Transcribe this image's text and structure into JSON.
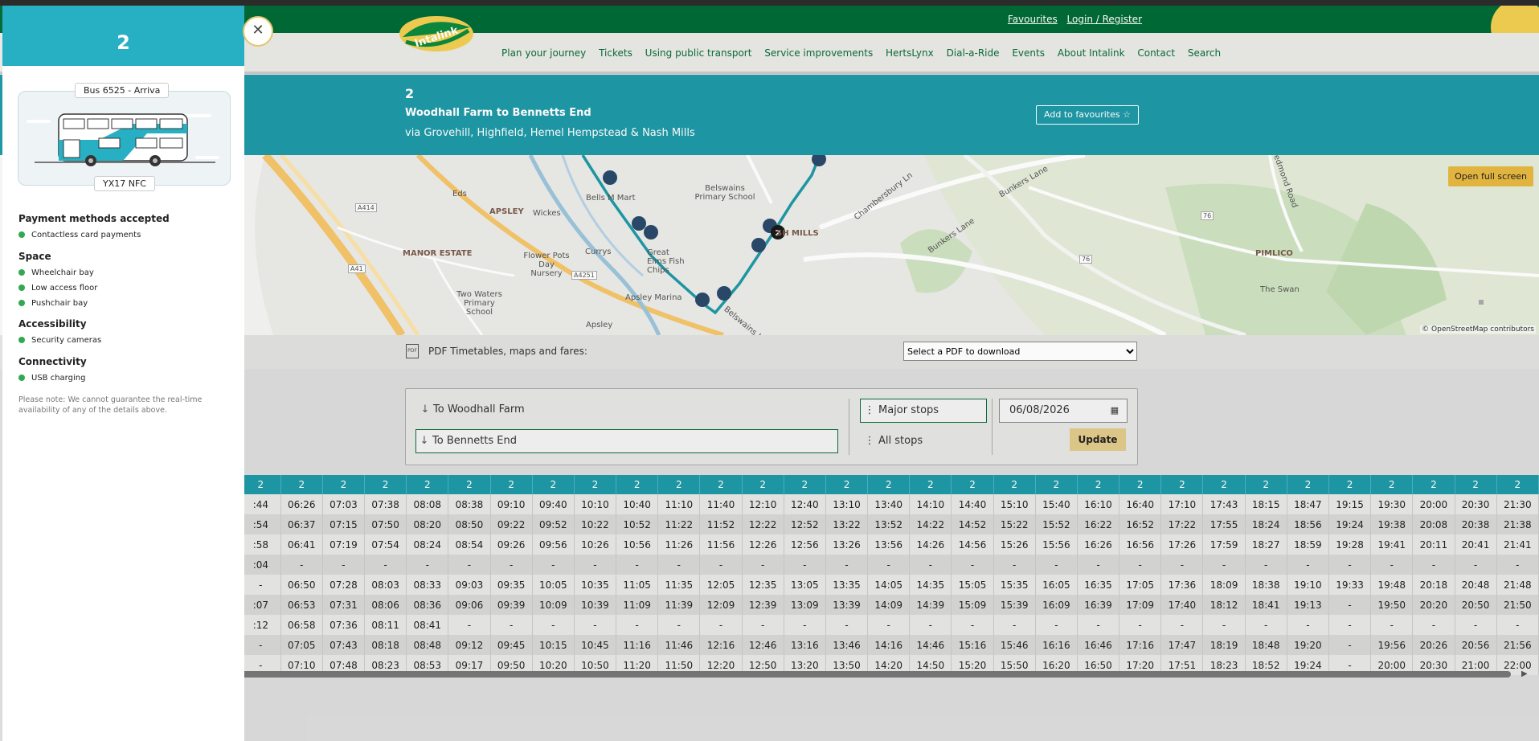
{
  "header": {
    "links": [
      "Favourites",
      "Login / Register"
    ],
    "logo_text": "Intalink",
    "nav": [
      "Plan your journey",
      "Tickets",
      "Using public transport",
      "Service improvements",
      "HertsLynx",
      "Dial-a-Ride",
      "Events",
      "About Intalink",
      "Contact",
      "Search"
    ]
  },
  "route": {
    "number": "2",
    "title": "Woodhall Farm to Bennetts End",
    "via": "via Grovehill, Highfield, Hemel Hempstead & Nash Mills",
    "favourite_label": "Add to favourites",
    "favourite_icon": "star-icon"
  },
  "map": {
    "fullscreen_label": "Open full screen",
    "attribution": "© OpenStreetMap contributors",
    "labels": [
      "APSLEY",
      "MANOR ESTATE",
      "PIMLICO",
      "SH MILLS",
      "Eds",
      "Wickes",
      "Bells M Mart",
      "Belswains Primary School",
      "Flower Pots Day Nursery",
      "Currys",
      "Great Elms Fish Chips",
      "Two Waters Primary School",
      "Apsley Marina",
      "Apsley",
      "The Swan",
      "A414",
      "A41",
      "A4251",
      "76",
      "Chambersbury Ln",
      "Bunkers Lane",
      "Bedmond Road",
      "Belswains Lane"
    ],
    "vehicle_badge": "2"
  },
  "pdf": {
    "label": "PDF Timetables, maps and fares:",
    "select_value": "Select a PDF to download"
  },
  "filter": {
    "directions": [
      "To Woodhall Farm",
      "To Bennetts End"
    ],
    "selected_direction": "To Bennetts End",
    "stop_options": [
      "Major stops",
      "All stops"
    ],
    "selected_stop_option": "Major stops",
    "date": "06/08/2026",
    "update_label": "Update"
  },
  "timetable": {
    "headers": [
      "2",
      "2",
      "2",
      "2",
      "2",
      "2",
      "2",
      "2",
      "2",
      "2",
      "2",
      "2",
      "2",
      "2",
      "2",
      "2",
      "2",
      "2",
      "2",
      "2",
      "2",
      "2",
      "2",
      "2",
      "2",
      "2",
      "2",
      "2",
      "2",
      "2",
      "2"
    ],
    "rows": [
      [
        ":44",
        "06:26",
        "07:03",
        "07:38",
        "08:08",
        "08:38",
        "09:10",
        "09:40",
        "10:10",
        "10:40",
        "11:10",
        "11:40",
        "12:10",
        "12:40",
        "13:10",
        "13:40",
        "14:10",
        "14:40",
        "15:10",
        "15:40",
        "16:10",
        "16:40",
        "17:10",
        "17:43",
        "18:15",
        "18:47",
        "19:15",
        "19:30",
        "20:00",
        "20:30",
        "21:30"
      ],
      [
        ":54",
        "06:37",
        "07:15",
        "07:50",
        "08:20",
        "08:50",
        "09:22",
        "09:52",
        "10:22",
        "10:52",
        "11:22",
        "11:52",
        "12:22",
        "12:52",
        "13:22",
        "13:52",
        "14:22",
        "14:52",
        "15:22",
        "15:52",
        "16:22",
        "16:52",
        "17:22",
        "17:55",
        "18:24",
        "18:56",
        "19:24",
        "19:38",
        "20:08",
        "20:38",
        "21:38"
      ],
      [
        ":58",
        "06:41",
        "07:19",
        "07:54",
        "08:24",
        "08:54",
        "09:26",
        "09:56",
        "10:26",
        "10:56",
        "11:26",
        "11:56",
        "12:26",
        "12:56",
        "13:26",
        "13:56",
        "14:26",
        "14:56",
        "15:26",
        "15:56",
        "16:26",
        "16:56",
        "17:26",
        "17:59",
        "18:27",
        "18:59",
        "19:28",
        "19:41",
        "20:11",
        "20:41",
        "21:41"
      ],
      [
        ":04",
        "-",
        "-",
        "-",
        "-",
        "-",
        "-",
        "-",
        "-",
        "-",
        "-",
        "-",
        "-",
        "-",
        "-",
        "-",
        "-",
        "-",
        "-",
        "-",
        "-",
        "-",
        "-",
        "-",
        "-",
        "-",
        "-",
        "-",
        "-",
        "-",
        "-"
      ],
      [
        "-",
        "06:50",
        "07:28",
        "08:03",
        "08:33",
        "09:03",
        "09:35",
        "10:05",
        "10:35",
        "11:05",
        "11:35",
        "12:05",
        "12:35",
        "13:05",
        "13:35",
        "14:05",
        "14:35",
        "15:05",
        "15:35",
        "16:05",
        "16:35",
        "17:05",
        "17:36",
        "18:09",
        "18:38",
        "19:10",
        "19:33",
        "19:48",
        "20:18",
        "20:48",
        "21:48"
      ],
      [
        ":07",
        "06:53",
        "07:31",
        "08:06",
        "08:36",
        "09:06",
        "09:39",
        "10:09",
        "10:39",
        "11:09",
        "11:39",
        "12:09",
        "12:39",
        "13:09",
        "13:39",
        "14:09",
        "14:39",
        "15:09",
        "15:39",
        "16:09",
        "16:39",
        "17:09",
        "17:40",
        "18:12",
        "18:41",
        "19:13",
        "-",
        "19:50",
        "20:20",
        "20:50",
        "21:50"
      ],
      [
        ":12",
        "06:58",
        "07:36",
        "08:11",
        "08:41",
        "-",
        "-",
        "-",
        "-",
        "-",
        "-",
        "-",
        "-",
        "-",
        "-",
        "-",
        "-",
        "-",
        "-",
        "-",
        "-",
        "-",
        "-",
        "-",
        "-",
        "-",
        "-",
        "-",
        "-",
        "-",
        "-"
      ],
      [
        "-",
        "07:05",
        "07:43",
        "08:18",
        "08:48",
        "09:12",
        "09:45",
        "10:15",
        "10:45",
        "11:16",
        "11:46",
        "12:16",
        "12:46",
        "13:16",
        "13:46",
        "14:16",
        "14:46",
        "15:16",
        "15:46",
        "16:16",
        "16:46",
        "17:16",
        "17:47",
        "18:19",
        "18:48",
        "19:20",
        "-",
        "19:56",
        "20:26",
        "20:56",
        "21:56"
      ],
      [
        "-",
        "07:10",
        "07:48",
        "08:23",
        "08:53",
        "09:17",
        "09:50",
        "10:20",
        "10:50",
        "11:20",
        "11:50",
        "12:20",
        "12:50",
        "13:20",
        "13:50",
        "14:20",
        "14:50",
        "15:20",
        "15:50",
        "16:20",
        "16:50",
        "17:20",
        "17:51",
        "18:23",
        "18:52",
        "19:24",
        "-",
        "20:00",
        "20:30",
        "21:00",
        "22:00"
      ]
    ]
  },
  "sidebar": {
    "route_number": "2",
    "bus_label": "Bus 6525 - Arriva",
    "registration": "YX17 NFC",
    "sections": [
      {
        "title": "Payment methods accepted",
        "items": [
          "Contactless card payments"
        ]
      },
      {
        "title": "Space",
        "items": [
          "Wheelchair bay",
          "Low access floor",
          "Pushchair bay"
        ]
      },
      {
        "title": "Accessibility",
        "items": [
          "Security cameras"
        ]
      },
      {
        "title": "Connectivity",
        "items": [
          "USB charging"
        ]
      }
    ],
    "note": "Please note: We cannot guarantee the real-time availability of any of the details above.",
    "close_icon": "close-icon",
    "accent_color": "#27b0c4",
    "check_color": "#32a852"
  }
}
